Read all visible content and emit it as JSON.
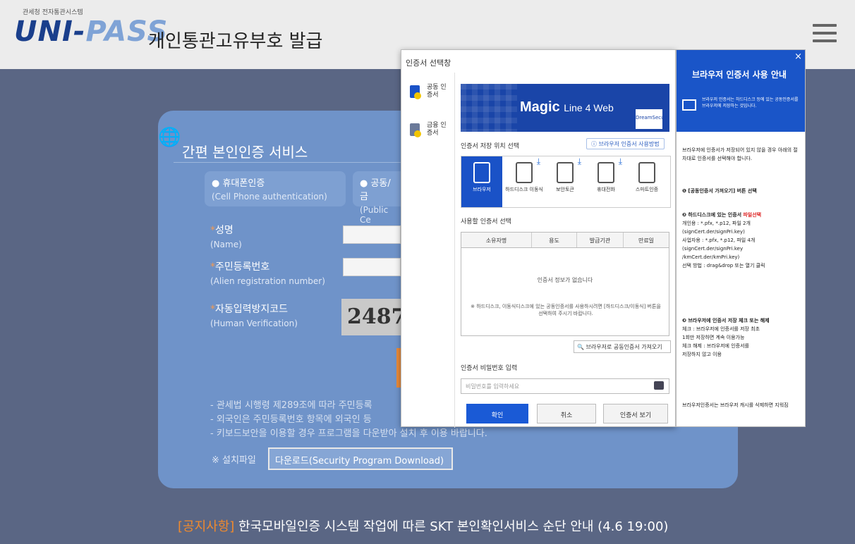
{
  "header": {
    "org": "관세청 전자통관시스템",
    "logo": {
      "left": "UNI-",
      "right": "PASS"
    },
    "title": "개인통관고유부호 발급",
    "menu_icon": "hamburger-icon"
  },
  "form": {
    "section_title": "간편 본인인증 서비스",
    "tabs": [
      {
        "label": "● 휴대폰인증",
        "sub": "(Cell Phone authentication)"
      },
      {
        "label": "● 공동/금",
        "sub": "(Public Ce"
      }
    ],
    "fields": {
      "name": {
        "label": "성명",
        "sub": "(Name)"
      },
      "regno": {
        "label": "주민등록번호",
        "sub": "(Alien registration number)"
      },
      "captcha": {
        "label": "자동입력방지코드",
        "sub": "(Human Verification)",
        "code": "2487"
      }
    },
    "notes": [
      "- 관세법 시행령 제289조에 따라 주민등록",
      "- 외국인은 주민등록번호 항목에 외국인 등",
      "- 키보드보안을 이용할 경우 프로그램을 다운받아 설치 후 이용 바랍니다."
    ],
    "download_label": "※ 설치파일",
    "download_button": "다운로드(Security Program Download)"
  },
  "notice": {
    "tag": "[공지사항]",
    "text": " 한국모바일인증 시스템 작업에 따른 SKT 본인확인서비스 순단 안내 (4.6 19:00)"
  },
  "dialog": {
    "title": "인증서 선택창",
    "sidebar": [
      {
        "label": "공동 인증서",
        "color": "#1a52c7"
      },
      {
        "label": "금융 인증서",
        "color": "#6b7a99"
      }
    ],
    "banner": {
      "title": "Magic",
      "subtitle": "Line 4 Web",
      "badge": "DreamSecurity"
    },
    "location_label": "인증서 저장 위치 선택",
    "location_help": "ⓘ 브라우저 인증서 사용방법",
    "locations": [
      {
        "label": "브라우저",
        "active": true
      },
      {
        "label": "하드디스크 이동식",
        "active": false
      },
      {
        "label": "보안토큰",
        "active": false
      },
      {
        "label": "휴대전화",
        "active": false
      },
      {
        "label": "스마트인증",
        "active": false
      }
    ],
    "use_label": "사용할 인증서 선택",
    "table_headers": [
      "소유자명",
      "용도",
      "발급기관",
      "만료일"
    ],
    "empty_text": "인증서 정보가 없습니다",
    "hint": "※ 하드디스크, 이동식디스크에 있는 공동인증서를 사용하시려면 [하드디스크/이동식] 버튼을 선택하여 주시기 바랍니다.",
    "import_button": "🔍 브라우저로 공동인증서 가져오기",
    "password_label": "인증서 비밀번호 입력",
    "password_placeholder": "비밀번호를 입력하세요",
    "buttons": {
      "ok": "확인",
      "cancel": "취소",
      "view": "인증서 보기"
    }
  },
  "guide": {
    "close": "×",
    "title": "브라우저 인증서 사용 안내",
    "note": "브라우저 인증서는 하드디스크 등에 있는 공동인증서를 브라우저에 저장하는 것입니다.",
    "intro": "브라우저에 인증서가 저장되어 있지 않을 경우 아래의 절차대로 인증서를 선택해야 합니다.",
    "step1": "❶ [공동인증서 가져오기] 버튼 선택",
    "step2_head": "❷ 하드디스크에 있는 인증서",
    "step2_red": "파일선택",
    "step2_lines": [
      "개인용 : *.pfx, *.p12, 파일 2개",
      "(signCert.der/signPri.key)",
      "사업자용 : *.pfx, *.p12, 파일 4개",
      "(signCert.der/signPri.key",
      "/kmCert.der/kmPri.key)",
      "선택 방법 : drag&drop 또는 열기 클릭"
    ],
    "step3_head": "❸ 브라우저에 인증서 저장 체크 또는 해제",
    "step3_lines": [
      "체크 : 브라우저에 인증서를 저장 최초",
      "1회만 저장하면 계속 이용가능",
      "체크 해제 : 브라우저에 인증서를",
      "저장하지 않고 이용"
    ],
    "footer": "브라우저인증서는 브라우저 캐시를 삭제하면 지워짐"
  }
}
